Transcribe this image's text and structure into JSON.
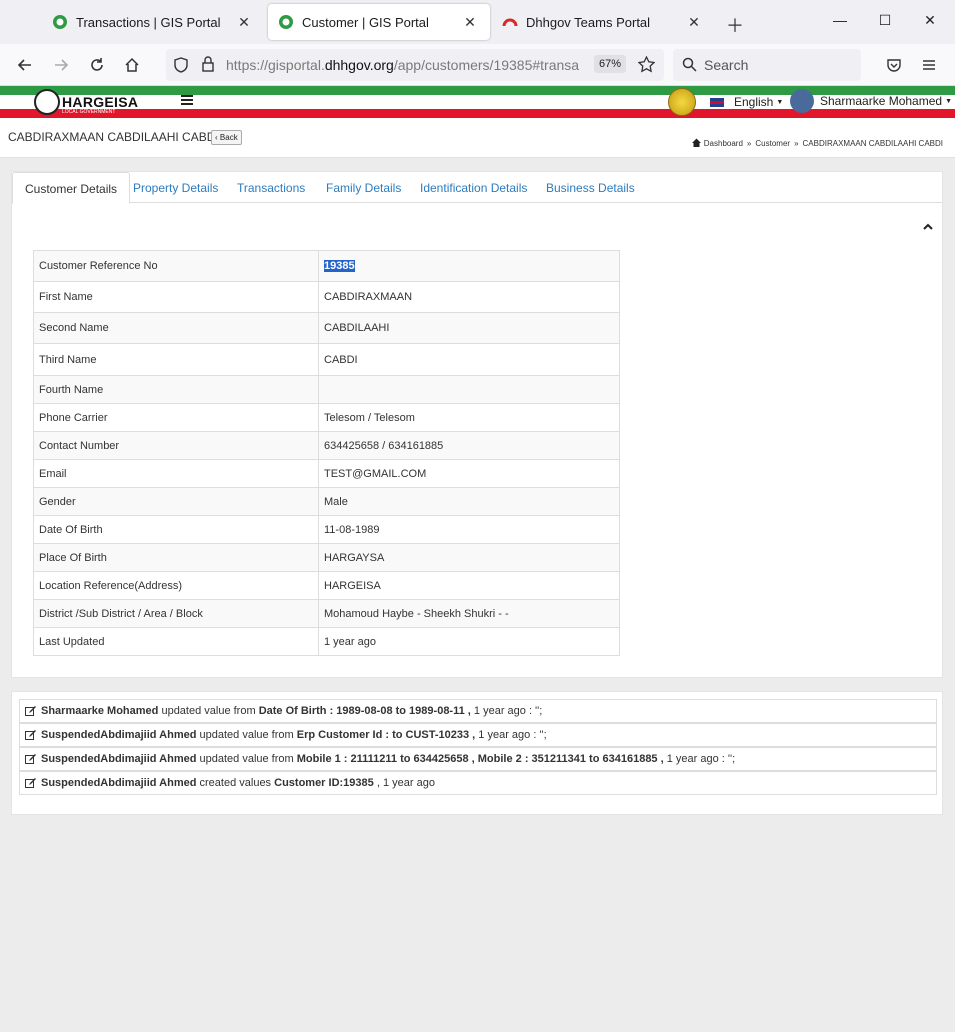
{
  "browser": {
    "tabs": [
      {
        "title": "Transactions | GIS Portal",
        "active": false
      },
      {
        "title": "Customer | GIS Portal",
        "active": true
      },
      {
        "title": "Dhhgov Teams Portal",
        "active": false
      }
    ],
    "url_prefix": "https://gisportal.",
    "url_domain": "dhhgov.org",
    "url_path": "/app/customers/19385#transa",
    "zoom": "67%",
    "search_placeholder": "Search"
  },
  "header": {
    "logo_text": "HARGEISA",
    "logo_sub": "LOCAL GOVERNMENT",
    "language": "English",
    "user_name": "Sharmaarke Mohamed"
  },
  "page": {
    "title": "CABDIRAXMAAN CABDILAAHI CABDI",
    "back_label": "Back",
    "breadcrumbs": [
      "Dashboard",
      "Customer",
      "CABDIRAXMAAN CABDILAAHI CABDI"
    ]
  },
  "tabs": [
    "Customer Details",
    "Property Details",
    "Transactions",
    "Family Details",
    "Identification Details",
    "Business Details"
  ],
  "details": [
    {
      "label": "Customer Reference No",
      "value": "19385"
    },
    {
      "label": "First Name",
      "value": "CABDIRAXMAAN"
    },
    {
      "label": "Second Name",
      "value": "CABDILAAHI"
    },
    {
      "label": "Third Name",
      "value": "CABDI"
    },
    {
      "label": "Fourth Name",
      "value": ""
    },
    {
      "label": "Phone Carrier",
      "value": "Telesom / Telesom"
    },
    {
      "label": "Contact Number",
      "value": "634425658 / 634161885"
    },
    {
      "label": "Email",
      "value": "TEST@GMAIL.COM"
    },
    {
      "label": "Gender",
      "value": "Male"
    },
    {
      "label": "Date Of Birth",
      "value": "11-08-1989"
    },
    {
      "label": "Place Of Birth",
      "value": "HARGAYSA"
    },
    {
      "label": "Location Reference(Address)",
      "value": "HARGEISA"
    },
    {
      "label": "District /Sub District / Area / Block",
      "value": "Mohamoud Haybe - Sheekh Shukri - -"
    },
    {
      "label": "Last Updated",
      "value": "1 year ago"
    }
  ],
  "log": [
    {
      "user": "Sharmaarke Mohamed",
      "action": "updated value from",
      "detail": "Date Of Birth : 1989-08-08 to 1989-08-11 ,",
      "time": "1 year ago : '';"
    },
    {
      "user": "SuspendedAbdimajiid Ahmed",
      "action": "updated value from",
      "detail": "Erp Customer Id : to CUST-10233 ,",
      "time": "1 year ago : '';"
    },
    {
      "user": "SuspendedAbdimajiid Ahmed",
      "action": "updated value from",
      "detail": "Mobile 1 : 21111211 to 634425658 , Mobile 2 : 351211341 to 634161885 ,",
      "time": "1 year ago : '';"
    },
    {
      "user": "SuspendedAbdimajiid Ahmed",
      "action": "created values",
      "detail": "Customer ID:19385",
      "time": ", 1 year ago"
    }
  ]
}
